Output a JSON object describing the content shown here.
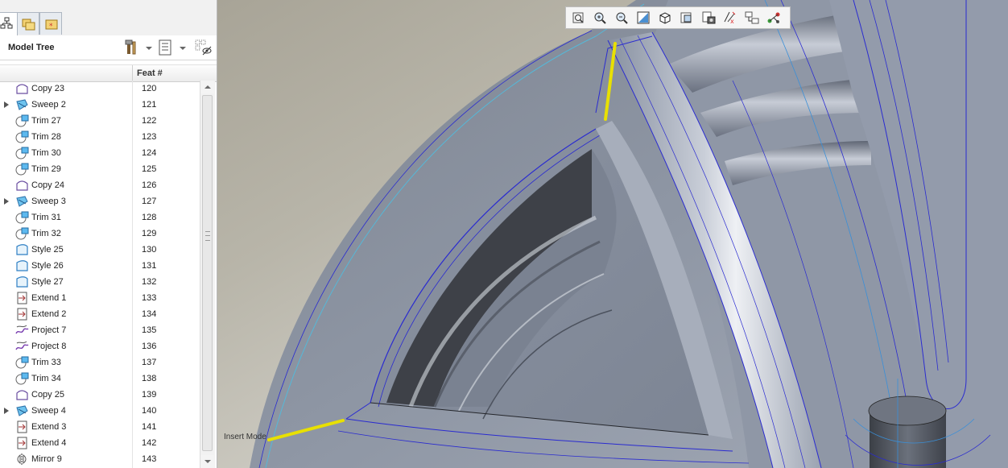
{
  "model_tree": {
    "title": "Model Tree",
    "column_header": "Feat #",
    "items": [
      {
        "label": "Copy 23",
        "feat": "120",
        "icon": "copy-feature-icon",
        "expandable": false
      },
      {
        "label": "Sweep 2",
        "feat": "121",
        "icon": "sweep-feature-icon",
        "expandable": true
      },
      {
        "label": "Trim 27",
        "feat": "122",
        "icon": "trim-feature-icon",
        "expandable": false
      },
      {
        "label": "Trim 28",
        "feat": "123",
        "icon": "trim-feature-icon",
        "expandable": false
      },
      {
        "label": "Trim 30",
        "feat": "124",
        "icon": "trim-feature-icon",
        "expandable": false
      },
      {
        "label": "Trim 29",
        "feat": "125",
        "icon": "trim-feature-icon",
        "expandable": false
      },
      {
        "label": "Copy 24",
        "feat": "126",
        "icon": "copy-feature-icon",
        "expandable": false
      },
      {
        "label": "Sweep 3",
        "feat": "127",
        "icon": "sweep-feature-icon",
        "expandable": true
      },
      {
        "label": "Trim 31",
        "feat": "128",
        "icon": "trim-feature-icon",
        "expandable": false
      },
      {
        "label": "Trim 32",
        "feat": "129",
        "icon": "trim-feature-icon",
        "expandable": false
      },
      {
        "label": "Style 25",
        "feat": "130",
        "icon": "style-feature-icon",
        "expandable": false
      },
      {
        "label": "Style 26",
        "feat": "131",
        "icon": "style-feature-icon",
        "expandable": false
      },
      {
        "label": "Style 27",
        "feat": "132",
        "icon": "style-feature-icon",
        "expandable": false
      },
      {
        "label": "Extend 1",
        "feat": "133",
        "icon": "extend-feature-icon",
        "expandable": false
      },
      {
        "label": "Extend 2",
        "feat": "134",
        "icon": "extend-feature-icon",
        "expandable": false
      },
      {
        "label": "Project 7",
        "feat": "135",
        "icon": "project-feature-icon",
        "expandable": false
      },
      {
        "label": "Project 8",
        "feat": "136",
        "icon": "project-feature-icon",
        "expandable": false
      },
      {
        "label": "Trim 33",
        "feat": "137",
        "icon": "trim-feature-icon",
        "expandable": false
      },
      {
        "label": "Trim 34",
        "feat": "138",
        "icon": "trim-feature-icon",
        "expandable": false
      },
      {
        "label": "Copy 25",
        "feat": "139",
        "icon": "copy-feature-icon",
        "expandable": false
      },
      {
        "label": "Sweep 4",
        "feat": "140",
        "icon": "sweep-feature-icon",
        "expandable": true
      },
      {
        "label": "Extend 3",
        "feat": "141",
        "icon": "extend-feature-icon",
        "expandable": false
      },
      {
        "label": "Extend 4",
        "feat": "142",
        "icon": "extend-feature-icon",
        "expandable": false
      },
      {
        "label": "Mirror 9",
        "feat": "143",
        "icon": "mirror-feature-icon",
        "expandable": false
      }
    ]
  },
  "nav_tabs": [
    "model-tree-tab",
    "folder-browser-tab",
    "favorites-tab"
  ],
  "view_toolbar": [
    "refit-icon",
    "zoom-in-icon",
    "zoom-out-icon",
    "repaint-icon",
    "display-style-icon",
    "saved-views-icon",
    "view-manager-icon",
    "datum-display-icon",
    "annotation-display-icon",
    "spin-center-icon"
  ],
  "viewport": {
    "insert_label": "Insert Mode",
    "colors": {
      "surface": "#8d94a2",
      "edge": "#2a2bd0",
      "highlight": "#e8e000"
    }
  }
}
